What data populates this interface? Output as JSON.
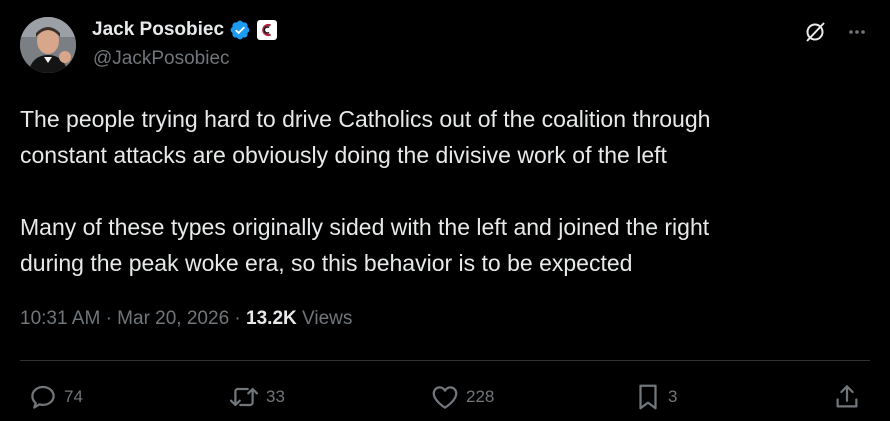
{
  "author": {
    "display_name": "Jack Posobiec",
    "handle": "@JackPosobiec",
    "verified": true,
    "affiliate_badge": "affiliate-badge-icon"
  },
  "header_actions": {
    "grok_icon": "grok-icon",
    "more_icon": "more-icon"
  },
  "tweet": {
    "paragraph_1_line_1": "The people trying hard to drive Catholics out of the coalition through",
    "paragraph_1_line_2": "constant attacks are obviously doing the divisive work of the left",
    "paragraph_2_line_1": "Many of these types originally sided with the left and joined the right",
    "paragraph_2_line_2": "during the peak woke era, so this behavior is to be expected"
  },
  "meta": {
    "time": "10:31 AM",
    "separator_1": "·",
    "date": "Mar 20, 2026",
    "separator_2": "·",
    "views_count": "13.2K",
    "views_label": "Views"
  },
  "actions": {
    "replies": "74",
    "reposts": "33",
    "likes": "228",
    "bookmarks": "3"
  },
  "colors": {
    "background": "#000000",
    "text_primary": "#e7e9ea",
    "text_secondary": "#71767b",
    "verified_blue": "#1d9bf0",
    "divider": "#2f3336"
  }
}
